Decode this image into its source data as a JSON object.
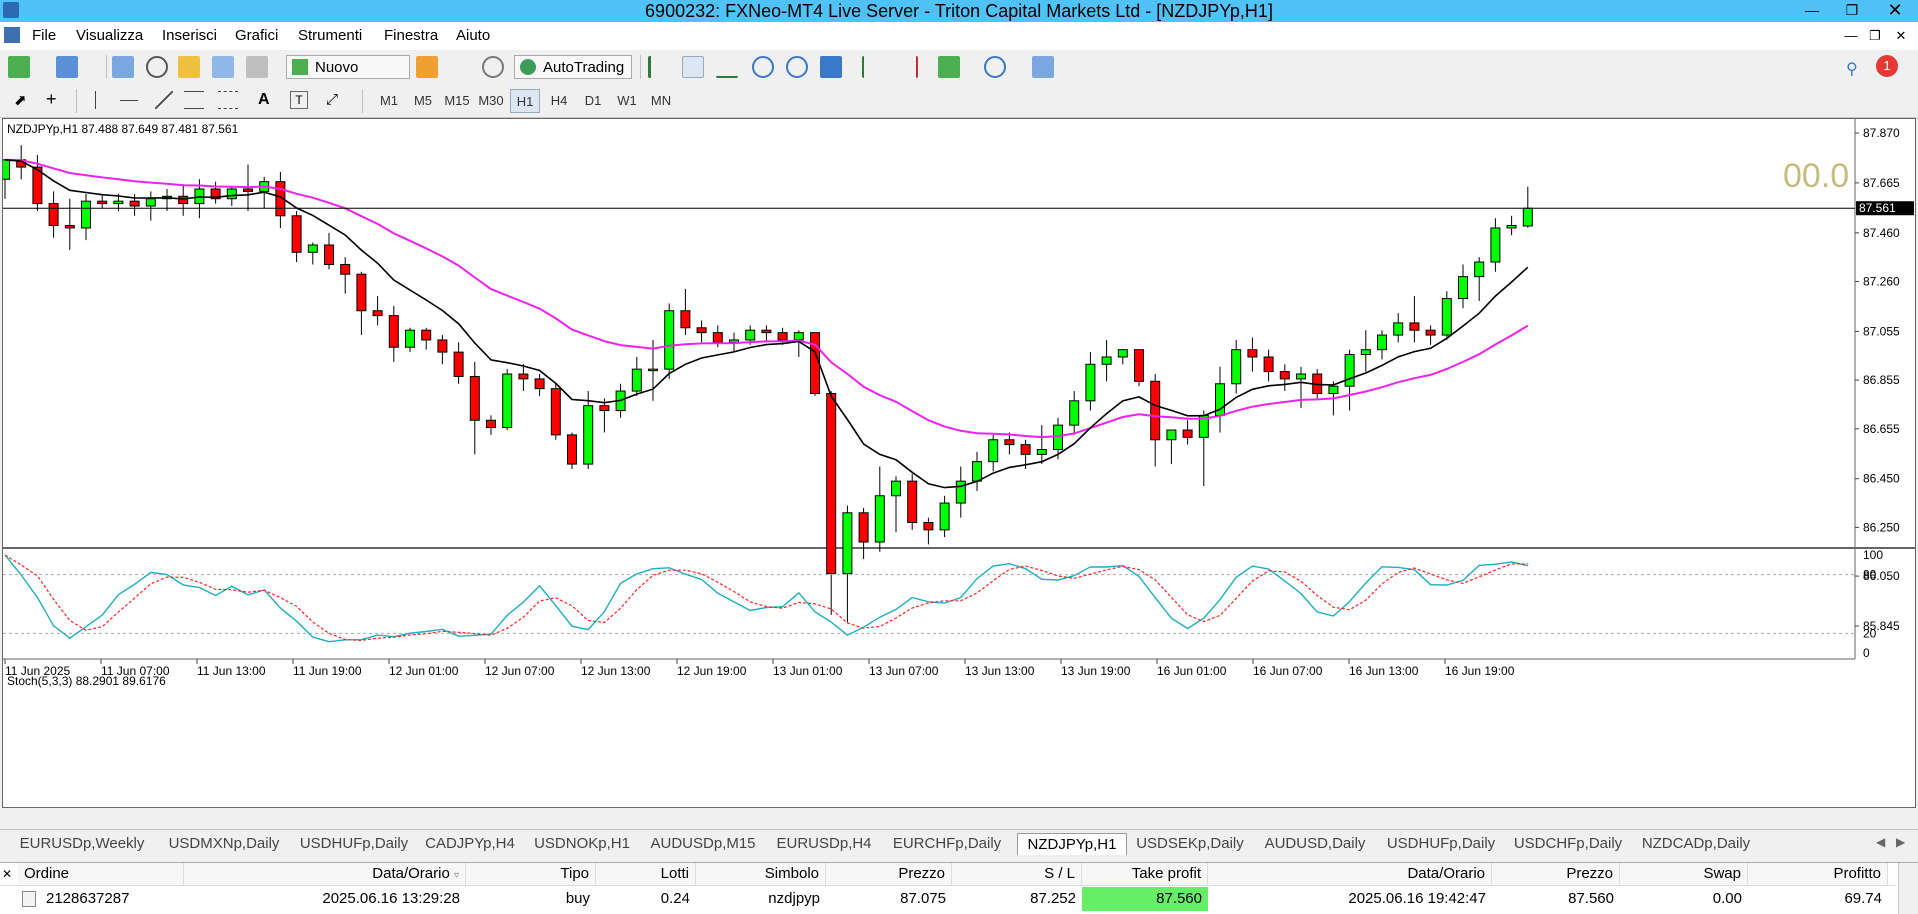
{
  "window": {
    "title": "6900232: FXNeo-MT4 Live Server - Triton Capital Markets Ltd - [NZDJPYp,H1]"
  },
  "menu": [
    "File",
    "Visualizza",
    "Inserisci",
    "Grafici",
    "Strumenti",
    "Finestra",
    "Aiuto"
  ],
  "toolbar": {
    "new_order": "Nuovo ordine",
    "autotrading": "AutoTrading",
    "timeframes": [
      "M1",
      "M5",
      "M15",
      "M30",
      "H1",
      "H4",
      "D1",
      "W1",
      "MN"
    ],
    "active_timeframe": "H1",
    "alert_count": "1"
  },
  "chart": {
    "header": "NZDJPYp,H1  87.488 87.649 87.481 87.561",
    "big_value": "00.0",
    "current_price": "87.561",
    "price_ticks": [
      "87.870",
      "87.665",
      "87.460",
      "87.260",
      "87.055",
      "86.855",
      "86.655",
      "86.450",
      "86.250",
      "86.050",
      "85.845"
    ],
    "time_labels": [
      "11 Jun 2025",
      "11 Jun 07:00",
      "11 Jun 13:00",
      "11 Jun 19:00",
      "12 Jun 01:00",
      "12 Jun 07:00",
      "12 Jun 13:00",
      "12 Jun 19:00",
      "13 Jun 01:00",
      "13 Jun 07:00",
      "13 Jun 13:00",
      "13 Jun 19:00",
      "16 Jun 01:00",
      "16 Jun 07:00",
      "16 Jun 13:00",
      "16 Jun 19:00"
    ],
    "candles": [
      [
        87.68,
        87.76,
        87.6,
        87.76
      ],
      [
        87.76,
        87.82,
        87.68,
        87.73
      ],
      [
        87.73,
        87.78,
        87.55,
        87.58
      ],
      [
        87.58,
        87.63,
        87.44,
        87.49
      ],
      [
        87.49,
        87.6,
        87.39,
        87.48
      ],
      [
        87.48,
        87.62,
        87.43,
        87.59
      ],
      [
        87.59,
        87.62,
        87.56,
        87.58
      ],
      [
        87.58,
        87.62,
        87.55,
        87.59
      ],
      [
        87.59,
        87.62,
        87.53,
        87.57
      ],
      [
        87.57,
        87.63,
        87.51,
        87.6
      ],
      [
        87.6,
        87.64,
        87.55,
        87.61
      ],
      [
        87.61,
        87.66,
        87.53,
        87.58
      ],
      [
        87.58,
        87.68,
        87.52,
        87.64
      ],
      [
        87.64,
        87.67,
        87.58,
        87.6
      ],
      [
        87.6,
        87.65,
        87.57,
        87.64
      ],
      [
        87.64,
        87.74,
        87.55,
        87.63
      ],
      [
        87.63,
        87.69,
        87.56,
        87.67
      ],
      [
        87.67,
        87.71,
        87.48,
        87.53
      ],
      [
        87.53,
        87.55,
        87.34,
        87.38
      ],
      [
        87.38,
        87.42,
        87.33,
        87.41
      ],
      [
        87.41,
        87.46,
        87.31,
        87.33
      ],
      [
        87.33,
        87.36,
        87.21,
        87.29
      ],
      [
        87.29,
        87.3,
        87.04,
        87.14
      ],
      [
        87.14,
        87.2,
        87.08,
        87.12
      ],
      [
        87.12,
        87.16,
        86.93,
        86.99
      ],
      [
        86.99,
        87.07,
        86.97,
        87.06
      ],
      [
        87.06,
        87.07,
        86.98,
        87.02
      ],
      [
        87.02,
        87.04,
        86.92,
        86.97
      ],
      [
        86.97,
        87.01,
        86.84,
        86.87
      ],
      [
        86.87,
        86.93,
        86.55,
        86.69
      ],
      [
        86.69,
        86.71,
        86.63,
        86.66
      ],
      [
        86.66,
        86.9,
        86.65,
        86.88
      ],
      [
        86.88,
        86.92,
        86.81,
        86.86
      ],
      [
        86.86,
        86.88,
        86.79,
        86.82
      ],
      [
        86.82,
        86.84,
        86.61,
        86.63
      ],
      [
        86.63,
        86.64,
        86.49,
        86.51
      ],
      [
        86.51,
        86.81,
        86.49,
        86.75
      ],
      [
        86.75,
        86.78,
        86.64,
        86.73
      ],
      [
        86.73,
        86.84,
        86.7,
        86.81
      ],
      [
        86.81,
        86.95,
        86.79,
        86.9
      ],
      [
        86.9,
        87.02,
        86.77,
        86.9
      ],
      [
        86.9,
        87.17,
        86.86,
        87.14
      ],
      [
        87.14,
        87.23,
        87.04,
        87.07
      ],
      [
        87.07,
        87.1,
        87.01,
        87.05
      ],
      [
        87.05,
        87.08,
        86.99,
        87.01
      ],
      [
        87.01,
        87.05,
        86.97,
        87.02
      ],
      [
        87.02,
        87.08,
        87.0,
        87.06
      ],
      [
        87.06,
        87.08,
        87.01,
        87.05
      ],
      [
        87.05,
        87.07,
        87.0,
        87.02
      ],
      [
        87.02,
        87.06,
        86.95,
        87.05
      ],
      [
        87.05,
        87.02,
        86.79,
        86.8
      ],
      [
        86.8,
        86.81,
        85.89,
        86.06
      ],
      [
        86.06,
        86.34,
        85.86,
        86.31
      ],
      [
        86.31,
        86.33,
        86.12,
        86.19
      ],
      [
        86.19,
        86.5,
        86.15,
        86.38
      ],
      [
        86.38,
        86.46,
        86.23,
        86.44
      ],
      [
        86.44,
        86.47,
        86.24,
        86.27
      ],
      [
        86.27,
        86.29,
        86.18,
        86.24
      ],
      [
        86.24,
        86.38,
        86.21,
        86.35
      ],
      [
        86.35,
        86.5,
        86.29,
        86.44
      ],
      [
        86.44,
        86.56,
        86.4,
        86.52
      ],
      [
        86.52,
        86.63,
        86.48,
        86.61
      ],
      [
        86.61,
        86.64,
        86.55,
        86.59
      ],
      [
        86.59,
        86.61,
        86.49,
        86.55
      ],
      [
        86.55,
        86.67,
        86.51,
        86.57
      ],
      [
        86.57,
        86.7,
        86.53,
        86.67
      ],
      [
        86.67,
        86.81,
        86.63,
        86.77
      ],
      [
        86.77,
        86.97,
        86.73,
        86.92
      ],
      [
        86.92,
        87.02,
        86.85,
        86.95
      ],
      [
        86.95,
        86.98,
        86.92,
        86.98
      ],
      [
        86.98,
        86.97,
        86.83,
        86.85
      ],
      [
        86.85,
        86.88,
        86.5,
        86.61
      ],
      [
        86.61,
        86.65,
        86.51,
        86.65
      ],
      [
        86.65,
        86.69,
        86.59,
        86.62
      ],
      [
        86.62,
        86.73,
        86.42,
        86.71
      ],
      [
        86.71,
        86.91,
        86.64,
        86.84
      ],
      [
        86.84,
        87.02,
        86.8,
        86.98
      ],
      [
        86.98,
        87.03,
        86.89,
        86.95
      ],
      [
        86.95,
        86.98,
        86.85,
        86.89
      ],
      [
        86.89,
        86.92,
        86.81,
        86.86
      ],
      [
        86.86,
        86.91,
        86.74,
        86.88
      ],
      [
        86.88,
        86.9,
        86.78,
        86.8
      ],
      [
        86.8,
        86.85,
        86.71,
        86.83
      ],
      [
        86.83,
        86.98,
        86.73,
        86.96
      ],
      [
        86.96,
        87.06,
        86.89,
        86.98
      ],
      [
        86.98,
        87.06,
        86.94,
        87.04
      ],
      [
        87.04,
        87.13,
        87.01,
        87.09
      ],
      [
        87.09,
        87.2,
        87.01,
        87.06
      ],
      [
        87.06,
        87.08,
        87.0,
        87.04
      ],
      [
        87.04,
        87.22,
        87.02,
        87.19
      ],
      [
        87.19,
        87.33,
        87.15,
        87.28
      ],
      [
        87.28,
        87.36,
        87.18,
        87.34
      ],
      [
        87.34,
        87.52,
        87.3,
        87.48
      ],
      [
        87.48,
        87.53,
        87.45,
        87.49
      ],
      [
        87.488,
        87.649,
        87.481,
        87.561
      ]
    ],
    "stoch_header": "Stoch(5,3,3) 88.2901 89.6176",
    "stoch_ticks": [
      "100",
      "80",
      "20",
      "0"
    ]
  },
  "tabs": [
    "EURUSDp,Weekly",
    "USDMXNp,Daily",
    "USDHUFp,Daily",
    "CADJPYp,H4",
    "USDNOKp,H1",
    "AUDUSDp,M15",
    "EURUSDp,H4",
    "EURCHFp,Daily",
    "NZDJPYp,H1",
    "USDSEKp,Daily",
    "AUDUSD,Daily",
    "USDHUFp,Daily",
    "USDCHFp,Daily",
    "NZDCADp,Daily"
  ],
  "active_tab": "NZDJPYp,H1",
  "terminal": {
    "headers": [
      "Ordine",
      "Data/Orario",
      "Tipo",
      "Lotti",
      "Simbolo",
      "Prezzo",
      "S / L",
      "Take profit",
      "Data/Orario",
      "Prezzo",
      "Swap",
      "Profitto"
    ],
    "row": [
      "2128637287",
      "2025.06.16 13:29:28",
      "buy",
      "0.24",
      "nzdjpyp",
      "87.075",
      "87.252",
      "87.560",
      "2025.06.16 19:42:47",
      "87.560",
      "0.00",
      "69.74"
    ]
  },
  "colors": {
    "bull": "#00ff00",
    "bear": "#ff0000",
    "ma_fast": "#000000",
    "ma_slow": "#ee22ee",
    "stoch_main": "#1eaec0",
    "stoch_signal": "#ff2222",
    "take_profit_bg": "#66ee66",
    "titlebar": "#4fc3f7"
  }
}
